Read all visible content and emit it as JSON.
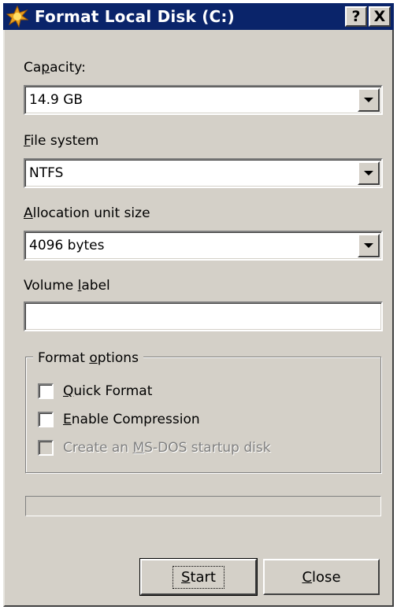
{
  "window": {
    "title": "Format Local Disk (C:)",
    "help_glyph": "?",
    "close_glyph": "X"
  },
  "capacity": {
    "label_pre": "Ca",
    "label_key": "p",
    "label_post": "acity:",
    "value": "14.9 GB"
  },
  "file_system": {
    "label_key": "F",
    "label_post": "ile system",
    "value": "NTFS"
  },
  "allocation": {
    "label_key": "A",
    "label_post": "llocation unit size",
    "value": "4096 bytes"
  },
  "volume_label": {
    "label_pre": "Volume ",
    "label_key": "l",
    "label_post": "abel",
    "value": ""
  },
  "format_options": {
    "legend_pre": "Format ",
    "legend_key": "o",
    "legend_post": "ptions",
    "quick_format": {
      "key": "Q",
      "rest": "uick Format",
      "checked": false,
      "enabled": true
    },
    "enable_compression": {
      "key": "E",
      "rest": "nable Compression",
      "checked": false,
      "enabled": true
    },
    "msdos_startup": {
      "pre": "Create an ",
      "key": "M",
      "rest": "S-DOS startup disk",
      "checked": false,
      "enabled": false
    }
  },
  "progress": {
    "fraction": 0
  },
  "buttons": {
    "start": {
      "key": "S",
      "rest": "tart"
    },
    "close": {
      "key": "C",
      "rest": "lose"
    }
  },
  "colors": {
    "titlebar": "#0a246a",
    "dialog_face": "#d4d0c8",
    "disabled_text": "#808080"
  },
  "icons": {
    "title": "format-disk-icon",
    "help": "help-icon",
    "close": "close-icon",
    "dropdown": "chevron-down-icon"
  }
}
